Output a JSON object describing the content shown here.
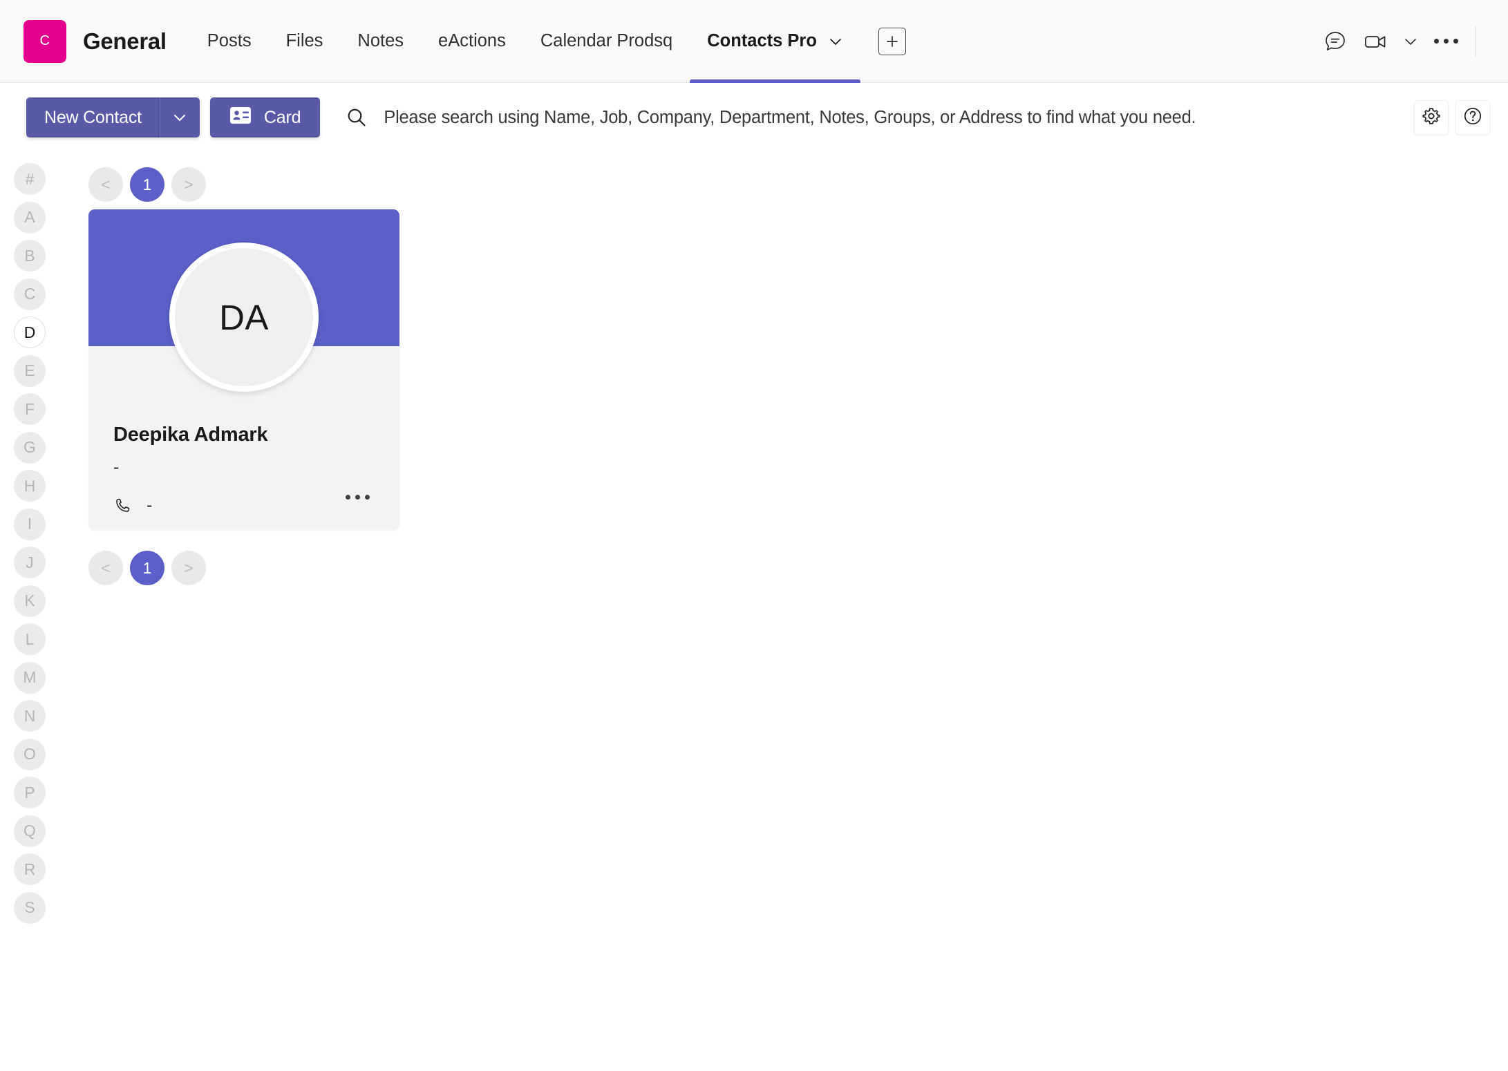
{
  "header": {
    "team_avatar_letter": "C",
    "team_name": "General",
    "tabs": [
      {
        "label": "Posts",
        "active": false
      },
      {
        "label": "Files",
        "active": false
      },
      {
        "label": "Notes",
        "active": false
      },
      {
        "label": "eActions",
        "active": false
      },
      {
        "label": "Calendar Prodsq",
        "active": false
      },
      {
        "label": "Contacts Pro",
        "active": true
      }
    ],
    "add_tab_label": "+",
    "icons": {
      "chat": "chat-bubble-icon",
      "video": "video-camera-icon",
      "video_chevron": "chevron-down-icon",
      "overflow": "more-options-icon"
    }
  },
  "toolbar": {
    "new_contact_label": "New Contact",
    "new_contact_chevron": "chevron-down-icon",
    "card_label": "Card",
    "card_icon": "contact-card-icon",
    "settings_icon": "gear-icon",
    "help_icon": "question-circle-icon"
  },
  "search": {
    "icon": "search-icon",
    "value": "",
    "placeholder": "Please search using Name, Job, Company, Department, Notes, Groups, or Address to find what you need."
  },
  "alpha_rail": {
    "selected": "D",
    "items": [
      "#",
      "A",
      "B",
      "C",
      "D",
      "E",
      "F",
      "G",
      "H",
      "I",
      "J",
      "K",
      "L",
      "M",
      "N",
      "O",
      "P",
      "Q",
      "R",
      "S"
    ]
  },
  "pagination": {
    "prev_label": "<",
    "next_label": ">",
    "current_page": "1"
  },
  "contacts": [
    {
      "initials": "DA",
      "name": "Deepika Admark",
      "job_title": "-",
      "phone": "-",
      "email": "-",
      "phone_icon": "phone-icon",
      "email_icon": "envelope-icon",
      "more_icon": "more-options-icon"
    }
  ],
  "colors": {
    "accent_purple": "#5b5fc7",
    "button_purple": "#585aa6",
    "team_avatar_pink": "#e3008c",
    "card_body_gray": "#f3f3f3",
    "rail_gray": "#ebebeb"
  }
}
